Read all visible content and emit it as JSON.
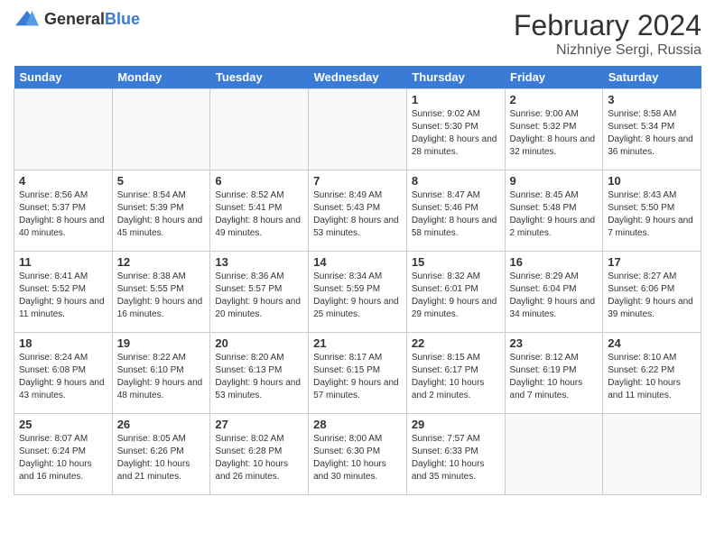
{
  "header": {
    "logo_general": "General",
    "logo_blue": "Blue",
    "title": "February 2024",
    "subtitle": "Nizhniye Sergi, Russia"
  },
  "columns": [
    "Sunday",
    "Monday",
    "Tuesday",
    "Wednesday",
    "Thursday",
    "Friday",
    "Saturday"
  ],
  "weeks": [
    [
      {
        "day": "",
        "info": ""
      },
      {
        "day": "",
        "info": ""
      },
      {
        "day": "",
        "info": ""
      },
      {
        "day": "",
        "info": ""
      },
      {
        "day": "1",
        "info": "Sunrise: 9:02 AM\nSunset: 5:30 PM\nDaylight: 8 hours\nand 28 minutes."
      },
      {
        "day": "2",
        "info": "Sunrise: 9:00 AM\nSunset: 5:32 PM\nDaylight: 8 hours\nand 32 minutes."
      },
      {
        "day": "3",
        "info": "Sunrise: 8:58 AM\nSunset: 5:34 PM\nDaylight: 8 hours\nand 36 minutes."
      }
    ],
    [
      {
        "day": "4",
        "info": "Sunrise: 8:56 AM\nSunset: 5:37 PM\nDaylight: 8 hours\nand 40 minutes."
      },
      {
        "day": "5",
        "info": "Sunrise: 8:54 AM\nSunset: 5:39 PM\nDaylight: 8 hours\nand 45 minutes."
      },
      {
        "day": "6",
        "info": "Sunrise: 8:52 AM\nSunset: 5:41 PM\nDaylight: 8 hours\nand 49 minutes."
      },
      {
        "day": "7",
        "info": "Sunrise: 8:49 AM\nSunset: 5:43 PM\nDaylight: 8 hours\nand 53 minutes."
      },
      {
        "day": "8",
        "info": "Sunrise: 8:47 AM\nSunset: 5:46 PM\nDaylight: 8 hours\nand 58 minutes."
      },
      {
        "day": "9",
        "info": "Sunrise: 8:45 AM\nSunset: 5:48 PM\nDaylight: 9 hours\nand 2 minutes."
      },
      {
        "day": "10",
        "info": "Sunrise: 8:43 AM\nSunset: 5:50 PM\nDaylight: 9 hours\nand 7 minutes."
      }
    ],
    [
      {
        "day": "11",
        "info": "Sunrise: 8:41 AM\nSunset: 5:52 PM\nDaylight: 9 hours\nand 11 minutes."
      },
      {
        "day": "12",
        "info": "Sunrise: 8:38 AM\nSunset: 5:55 PM\nDaylight: 9 hours\nand 16 minutes."
      },
      {
        "day": "13",
        "info": "Sunrise: 8:36 AM\nSunset: 5:57 PM\nDaylight: 9 hours\nand 20 minutes."
      },
      {
        "day": "14",
        "info": "Sunrise: 8:34 AM\nSunset: 5:59 PM\nDaylight: 9 hours\nand 25 minutes."
      },
      {
        "day": "15",
        "info": "Sunrise: 8:32 AM\nSunset: 6:01 PM\nDaylight: 9 hours\nand 29 minutes."
      },
      {
        "day": "16",
        "info": "Sunrise: 8:29 AM\nSunset: 6:04 PM\nDaylight: 9 hours\nand 34 minutes."
      },
      {
        "day": "17",
        "info": "Sunrise: 8:27 AM\nSunset: 6:06 PM\nDaylight: 9 hours\nand 39 minutes."
      }
    ],
    [
      {
        "day": "18",
        "info": "Sunrise: 8:24 AM\nSunset: 6:08 PM\nDaylight: 9 hours\nand 43 minutes."
      },
      {
        "day": "19",
        "info": "Sunrise: 8:22 AM\nSunset: 6:10 PM\nDaylight: 9 hours\nand 48 minutes."
      },
      {
        "day": "20",
        "info": "Sunrise: 8:20 AM\nSunset: 6:13 PM\nDaylight: 9 hours\nand 53 minutes."
      },
      {
        "day": "21",
        "info": "Sunrise: 8:17 AM\nSunset: 6:15 PM\nDaylight: 9 hours\nand 57 minutes."
      },
      {
        "day": "22",
        "info": "Sunrise: 8:15 AM\nSunset: 6:17 PM\nDaylight: 10 hours\nand 2 minutes."
      },
      {
        "day": "23",
        "info": "Sunrise: 8:12 AM\nSunset: 6:19 PM\nDaylight: 10 hours\nand 7 minutes."
      },
      {
        "day": "24",
        "info": "Sunrise: 8:10 AM\nSunset: 6:22 PM\nDaylight: 10 hours\nand 11 minutes."
      }
    ],
    [
      {
        "day": "25",
        "info": "Sunrise: 8:07 AM\nSunset: 6:24 PM\nDaylight: 10 hours\nand 16 minutes."
      },
      {
        "day": "26",
        "info": "Sunrise: 8:05 AM\nSunset: 6:26 PM\nDaylight: 10 hours\nand 21 minutes."
      },
      {
        "day": "27",
        "info": "Sunrise: 8:02 AM\nSunset: 6:28 PM\nDaylight: 10 hours\nand 26 minutes."
      },
      {
        "day": "28",
        "info": "Sunrise: 8:00 AM\nSunset: 6:30 PM\nDaylight: 10 hours\nand 30 minutes."
      },
      {
        "day": "29",
        "info": "Sunrise: 7:57 AM\nSunset: 6:33 PM\nDaylight: 10 hours\nand 35 minutes."
      },
      {
        "day": "",
        "info": ""
      },
      {
        "day": "",
        "info": ""
      }
    ]
  ]
}
